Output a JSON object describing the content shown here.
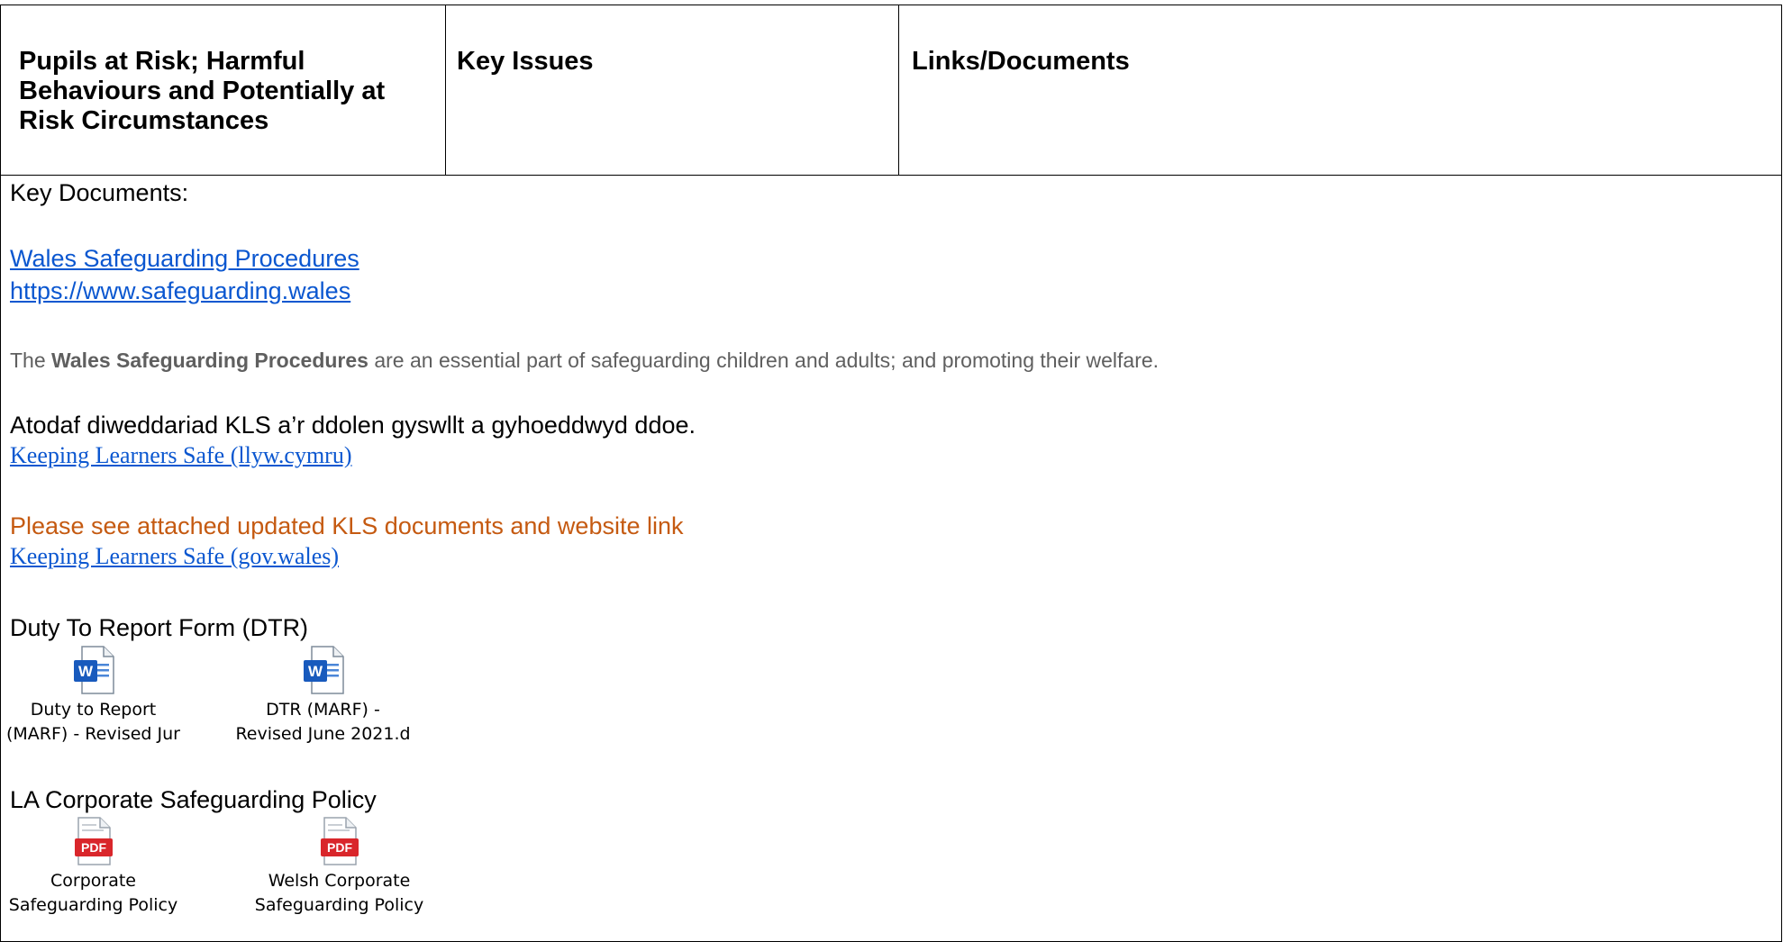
{
  "table": {
    "headers": [
      "Pupils at Risk;  Harmful Behaviours and Potentially at Risk Circumstances",
      "Key Issues",
      "Links/Documents"
    ]
  },
  "content": {
    "key_documents_label": "Key Documents:",
    "wsp_link": "Wales Safeguarding Procedures",
    "wsp_url": "https://www.safeguarding.wales",
    "wsp_desc_prefix": "The ",
    "wsp_desc_bold": "Wales Safeguarding Procedures",
    "wsp_desc_suffix": " are an essential part of safeguarding children and adults; and promoting their welfare.",
    "welsh_note": "Atodaf diweddariad KLS a’r ddolen gyswllt a gyhoeddwyd ddoe.",
    "kls_link_cy": "Keeping Learners Safe (llyw.cymru)",
    "english_note": "Please see attached updated KLS documents and website link",
    "kls_link_en": "Keeping Learners Safe (gov.wales)",
    "dtr_heading": "Duty To Report Form (DTR)",
    "dtr_attachments": [
      {
        "line1": "Duty to Report",
        "line2": "(MARF) - Revised Jur",
        "icon": "word-icon"
      },
      {
        "line1": "DTR (MARF) -",
        "line2": "Revised June 2021.d",
        "icon": "word-icon"
      }
    ],
    "policy_heading": "LA Corporate Safeguarding Policy",
    "policy_attachments": [
      {
        "line1": "Corporate",
        "line2": "Safeguarding Policy",
        "icon": "pdf-icon",
        "badge": "PDF"
      },
      {
        "line1": "Welsh Corporate",
        "line2": "Safeguarding Policy",
        "icon": "pdf-icon",
        "badge": "PDF"
      }
    ]
  },
  "colors": {
    "link": "#0b57d0",
    "orange_text": "#c55a11",
    "grey_text": "#5f5f5f",
    "word_blue": "#185abd",
    "pdf_red": "#d9262b"
  }
}
